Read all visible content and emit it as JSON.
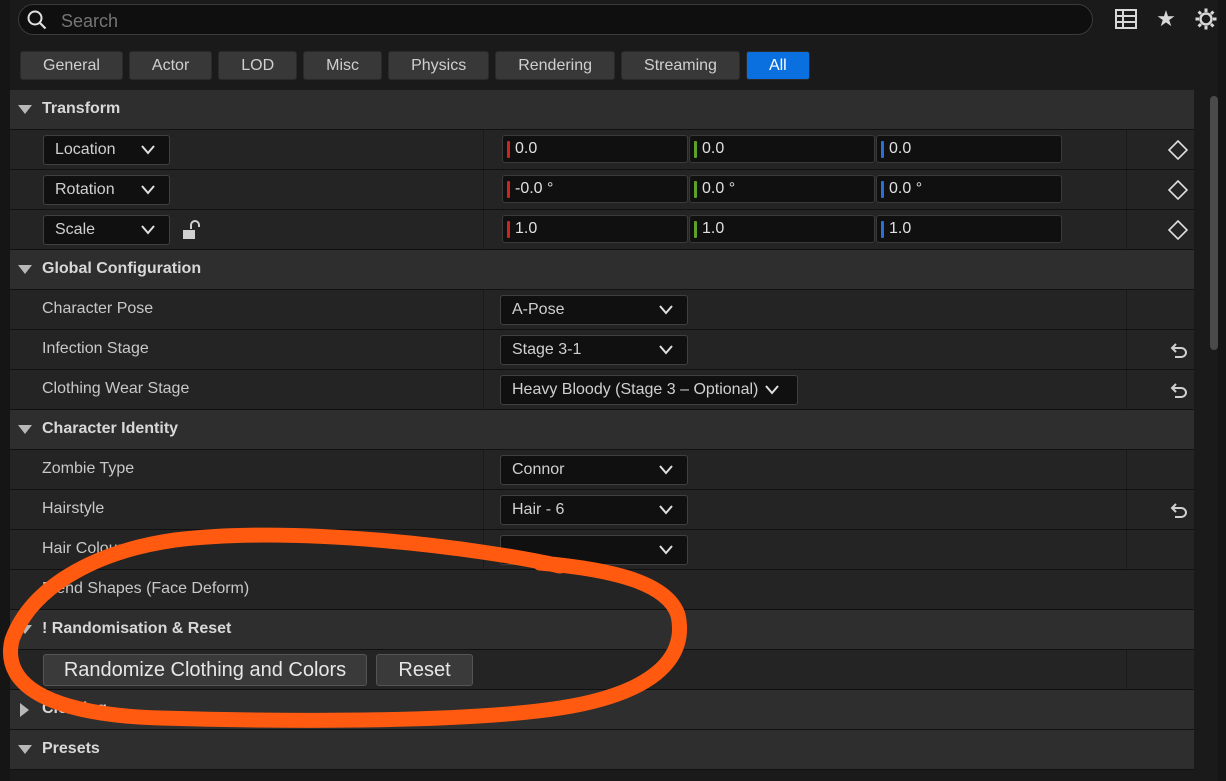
{
  "search": {
    "placeholder": "Search"
  },
  "toolbar_icons": [
    "table-icon",
    "star-icon",
    "gear-icon"
  ],
  "tabs": [
    "General",
    "Actor",
    "LOD",
    "Misc",
    "Physics",
    "Rendering",
    "Streaming",
    "All"
  ],
  "active_tab": "All",
  "transform": {
    "title": "Transform",
    "location": {
      "label": "Location",
      "x": "0.0",
      "y": "0.0",
      "z": "0.0"
    },
    "rotation": {
      "label": "Rotation",
      "x": "-0.0 °",
      "y": "0.0 °",
      "z": "0.0 °"
    },
    "scale": {
      "label": "Scale",
      "x": "1.0",
      "y": "1.0",
      "z": "1.0"
    }
  },
  "global_config": {
    "title": "Global Configuration",
    "character_pose": {
      "label": "Character Pose",
      "value": "A-Pose"
    },
    "infection_stage": {
      "label": "Infection Stage",
      "value": "Stage 3-1"
    },
    "clothing_wear_stage": {
      "label": "Clothing Wear Stage",
      "value": "Heavy Bloody (Stage 3 – Optional)"
    }
  },
  "character_identity": {
    "title": "Character Identity",
    "zombie_type": {
      "label": "Zombie Type",
      "value": "Connor"
    },
    "hairstyle": {
      "label": "Hairstyle",
      "value": "Hair - 6"
    },
    "hair_colour": {
      "label": "Hair Colour",
      "value": ""
    },
    "blend_shapes": {
      "label": "Blend Shapes (Face Deform)"
    }
  },
  "randomisation": {
    "title": "! Randomisation & Reset",
    "randomize_button": "Randomize Clothing and Colors",
    "reset_button": "Reset"
  },
  "clothing": {
    "title": "Clothing"
  },
  "presets": {
    "title": "Presets"
  },
  "colors": {
    "accent": "#0a70e0",
    "x_axis": "#c8281e",
    "y_axis": "#5ea12a",
    "z_axis": "#2a6fd6",
    "annotation": "#ff5a10"
  }
}
